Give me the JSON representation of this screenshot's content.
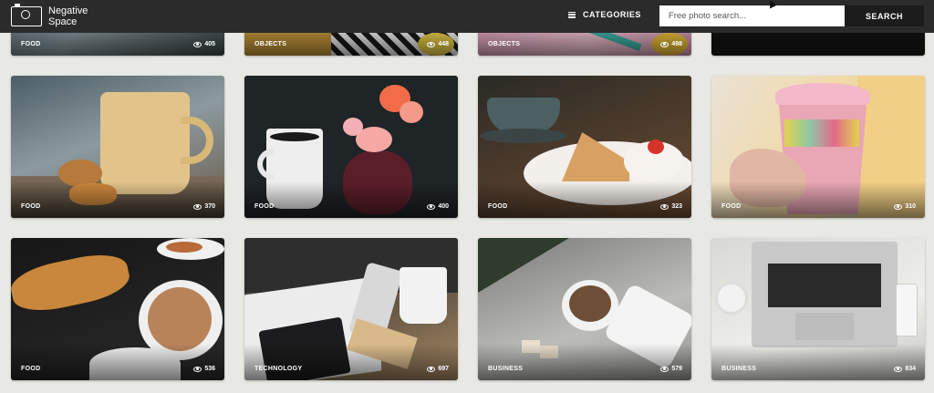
{
  "header": {
    "logo_line1": "Negative",
    "logo_line2": "Space",
    "categories_label": "CATEGORIES",
    "search_placeholder": "Free photo search...",
    "search_button": "SEARCH"
  },
  "rows": [
    [
      {
        "category": "FOOD",
        "views": "405"
      },
      {
        "category": "OBJECTS",
        "views": "448"
      },
      {
        "category": "OBJECTS",
        "views": "498"
      },
      {
        "category": "",
        "views": ""
      }
    ],
    [
      {
        "category": "FOOD",
        "views": "370"
      },
      {
        "category": "FOOD",
        "views": "400"
      },
      {
        "category": "FOOD",
        "views": "323"
      },
      {
        "category": "FOOD",
        "views": "310"
      }
    ],
    [
      {
        "category": "FOOD",
        "views": "536"
      },
      {
        "category": "TECHNOLOGY",
        "views": "697"
      },
      {
        "category": "BUSINESS",
        "views": "579"
      },
      {
        "category": "BUSINESS",
        "views": "834"
      }
    ]
  ]
}
